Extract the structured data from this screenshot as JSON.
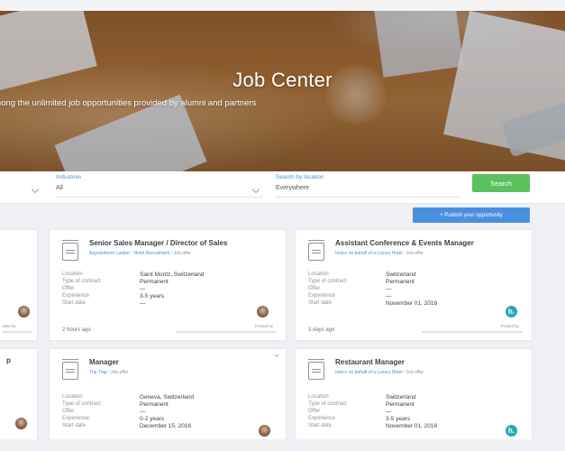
{
  "hero": {
    "title": "Job Center",
    "subtitle": "among the unlimited job opportunities provided by alumni and partners"
  },
  "filters": {
    "industries_label": "Industries",
    "industries_value": "All",
    "location_label": "Search by location",
    "location_value": "Everywhere",
    "search_button": "Search"
  },
  "publish_button": "+ Publish your opportunity",
  "labels": {
    "location": "Location",
    "contract": "Type of contract",
    "offer": "Offer",
    "experience": "Experience",
    "start_date": "Start date",
    "posted_by": "Posted by"
  },
  "left_partial": {
    "posted_by": "sted by",
    "card2_title": "p"
  },
  "jobs": [
    {
      "title": "Senior Sales Manager / Director of Sales",
      "company": "Appointment Ladder - Hotel Recruitment",
      "type": "Job offer",
      "location": "Saint Moritz, Switzerland",
      "contract": "Permanent",
      "offer": "—",
      "experience": "3-5 years",
      "start_date": "—",
      "time": "2 hours ago"
    },
    {
      "title": "Assistant Conference & Events Manager",
      "company": "hosco on behalf of a Luxury Hotel",
      "type": "Job offer",
      "location": "Switzerland",
      "contract": "Permanent",
      "offer": "—",
      "experience": "—",
      "start_date": "November 01, 2016",
      "time": "3 days ago"
    },
    {
      "title": "Manager",
      "company": "Trip Trap",
      "type": "Job offer",
      "location": "Geneva, Switzerland",
      "contract": "Permanent",
      "offer": "—",
      "experience": "0-2 years",
      "start_date": "December 15, 2016"
    },
    {
      "title": "Restaurant Manager",
      "company": "hosco on behalf of a Luxury Hotel",
      "type": "Job offer",
      "location": "Switzerland",
      "contract": "Permanent",
      "offer": "—",
      "experience": "3-5 years",
      "start_date": "November 01, 2016"
    }
  ],
  "logo_letter": "h."
}
